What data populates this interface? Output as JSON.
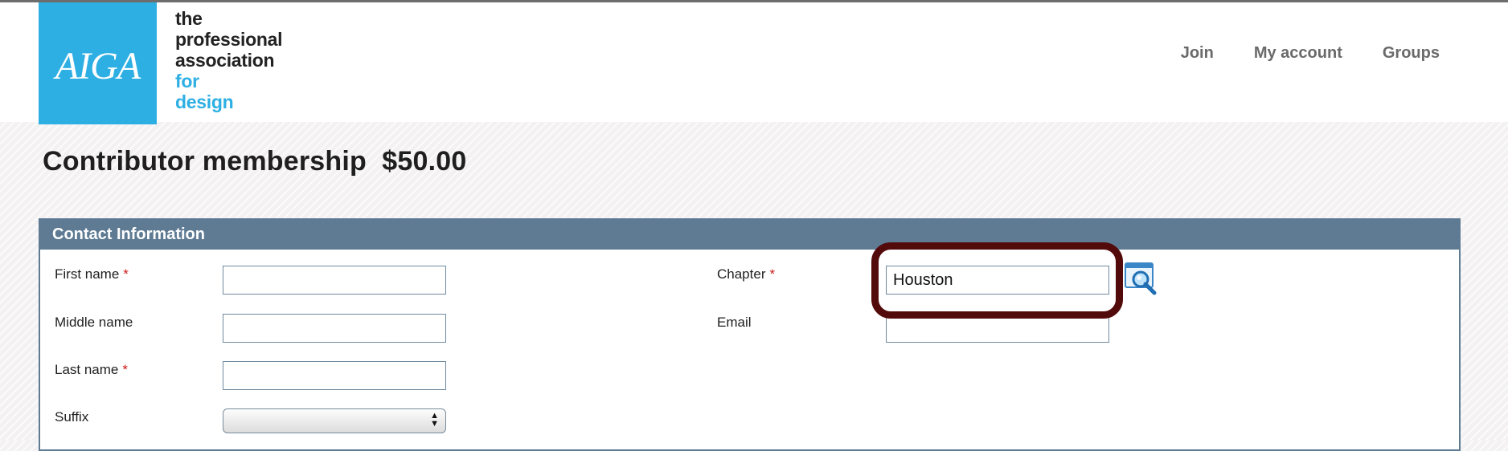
{
  "header": {
    "logo": "AIGA",
    "tagline": [
      "the",
      "professional",
      "association"
    ],
    "tagline_accent": [
      "for",
      "design"
    ],
    "nav": [
      "Join",
      "My account",
      "Groups"
    ]
  },
  "page": {
    "title": "Contributor membership  $50.00"
  },
  "contact": {
    "heading": "Contact Information",
    "required_marker": "*",
    "fields": {
      "first_name": {
        "label": "First name",
        "value": ""
      },
      "middle_name": {
        "label": "Middle name",
        "value": ""
      },
      "last_name": {
        "label": "Last name",
        "value": ""
      },
      "suffix": {
        "label": "Suffix",
        "value": ""
      },
      "chapter": {
        "label": "Chapter",
        "value": "Houston"
      },
      "email": {
        "label": "Email",
        "value": ""
      }
    }
  },
  "icons": {
    "chapter_lookup": "magnifier-lookup-icon",
    "select_arrows": "updown-arrows-icon"
  },
  "colors": {
    "brand_blue": "#2eafe3",
    "panel_header": "#5e7b93",
    "required": "#cc1a1a",
    "highlight": "#520a0a"
  }
}
